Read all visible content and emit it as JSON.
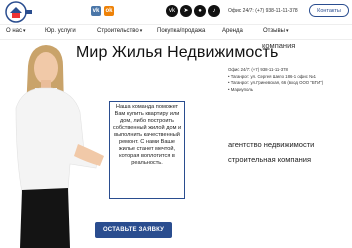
{
  "header": {
    "social": [
      {
        "name": "vk-icon",
        "glyph": "vk",
        "color": "#4a76a8"
      },
      {
        "name": "ok-icon",
        "glyph": "ok",
        "color": "#ee8208"
      },
      {
        "name": "vk-round-icon",
        "glyph": "vk",
        "color": "#111111"
      },
      {
        "name": "telegram-icon",
        "glyph": "➤",
        "color": "#111111"
      },
      {
        "name": "chat-icon",
        "glyph": "●",
        "color": "#111111"
      },
      {
        "name": "tiktok-icon",
        "glyph": "♪",
        "color": "#111111"
      }
    ],
    "office_phone": "Офис 24/7: (+7) 938-11-11-378",
    "contacts_label": "Контакты"
  },
  "nav": [
    {
      "label": "О нас",
      "dropdown": true
    },
    {
      "label": "Юр. услуги",
      "dropdown": false
    },
    {
      "label": "Строительство",
      "dropdown": true
    },
    {
      "label": "Покупка/продажа",
      "dropdown": false
    },
    {
      "label": "Аренда",
      "dropdown": false
    },
    {
      "label": "Отзывы",
      "dropdown": true
    }
  ],
  "hero": {
    "title": "Мир Жилья Недвижимость",
    "title_suffix": "компания",
    "addresses": [
      "Офис 24/7: (+7) 938-11-11-378",
      "• Таганрог: ул. Сергея Шило 186-1 офис №1",
      "• Таганрог: ул.Гриневская, 66 (вход ООО \"БТИ\")",
      "• Мариуполь"
    ],
    "team_text": "Наша команда поможет Вам купить квартиру или дом, либо построить собственный жилой дом и выполнить качественный ремонт. С нами Ваше жилье станет мечтой, которая воплотится в реальность.",
    "agency_line1": "агентство недвижимости",
    "agency_line2": "строительная компания",
    "cta_label": "ОСТАВЬТЕ ЗАЯВКУ"
  },
  "colors": {
    "brand": "#2a4d8f"
  }
}
